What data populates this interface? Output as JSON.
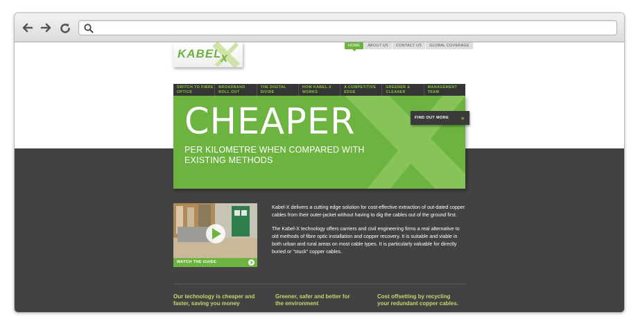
{
  "browser": {
    "url_value": "",
    "icons": [
      "back-arrow-icon",
      "forward-arrow-icon",
      "reload-icon",
      "search-icon"
    ]
  },
  "site": {
    "logo_text": "KABEL X",
    "top_nav": [
      {
        "label": "HOME",
        "active": true
      },
      {
        "label": "ABOUT US",
        "active": false
      },
      {
        "label": "CONTACT US",
        "active": false
      },
      {
        "label": "GLOBAL COVERAGE",
        "active": false
      }
    ],
    "main_nav": [
      "SWITCH TO FIBRE OPTICS",
      "BROADBAND ROLL OUT",
      "THE DIGITAL DIVIDE",
      "HOW KABEL-X WORKS",
      "A COMPETITIVE EDGE",
      "GREENER & CLEANER",
      "MANAGEMENT TEAM"
    ],
    "hero": {
      "title": "CHEAPER",
      "subtitle": "PER KILOMETRE WHEN COMPARED WITH EXISTING METHODS",
      "cta": "FIND OUT MORE"
    },
    "video": {
      "caption": "WATCH THE GUIDE"
    },
    "intro": {
      "p1": "Kabel-X delivers a cutting edge solution for cost-effective extraction of out-dated copper cables from their outer-jacket without having to dig the cables out of the ground first.",
      "p2": "The Kabel-X technology offers carriers and civil engineering firms a real alternative to old methods of fibre optic installation and copper recovery. It is suitable and viable in both urban and rural areas on most cable types. It is particularly valuable for directly buried or \"stuck\" copper cables."
    },
    "benefits": [
      "Our technology is cheaper and faster, saving you money",
      "Greener, safer and better for the environment",
      "Cost offsetting by recycling your redundant copper cables."
    ]
  },
  "colors": {
    "brand_green": "#6cb33f",
    "nav_green": "#8cc63f",
    "dark_bg": "#424242",
    "benefit_text": "#c3d86b"
  }
}
